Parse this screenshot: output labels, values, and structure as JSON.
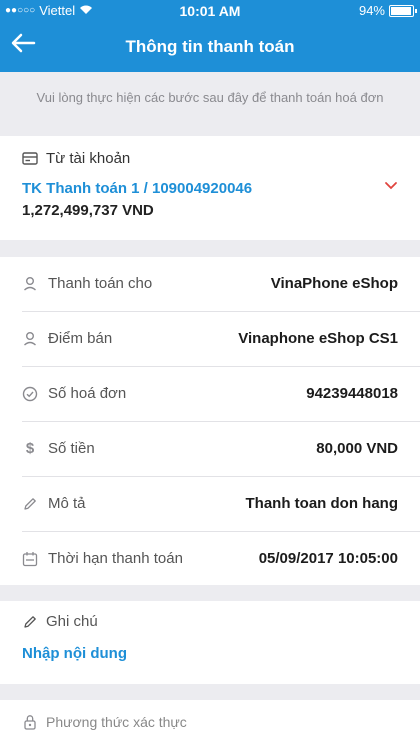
{
  "status_bar": {
    "carrier": "Viettel",
    "time": "10:01 AM",
    "battery": "94%"
  },
  "nav": {
    "title": "Thông tin thanh toán"
  },
  "notice": "Vui lòng thực hiện các bước sau đây để thanh toán hoá đơn",
  "account": {
    "label": "Từ tài khoản",
    "name": "TK Thanh toán 1 / 109004920046",
    "balance": "1,272,499,737 VND"
  },
  "details": [
    {
      "label": "Thanh toán cho",
      "value": "VinaPhone eShop",
      "icon": "person-icon"
    },
    {
      "label": "Điểm bán",
      "value": "Vinaphone eShop CS1",
      "icon": "person-icon"
    },
    {
      "label": "Số hoá đơn",
      "value": "94239448018",
      "icon": "check-circle-icon"
    },
    {
      "label": "Số tiền",
      "value": "80,000 VND",
      "icon": "dollar-icon"
    },
    {
      "label": "Mô tả",
      "value": "Thanh toan don hang",
      "icon": "pencil-icon"
    },
    {
      "label": "Thời hạn thanh toán",
      "value": "05/09/2017 10:05:00",
      "icon": "calendar-icon"
    }
  ],
  "note": {
    "label": "Ghi chú",
    "placeholder": "Nhập nội dung"
  },
  "auth": {
    "label": "Phương thức xác thực"
  },
  "colors": {
    "primary": "#1e8fd7",
    "accent_red": "#e0443e",
    "background": "#ececf0"
  }
}
